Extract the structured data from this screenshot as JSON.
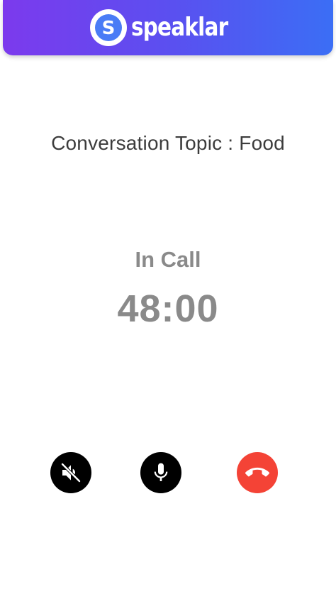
{
  "header": {
    "logo_text": "speaklar",
    "logo_letter": "S",
    "logo_icon": "speaklar-logo-icon",
    "gradient_start": "#7c3aed",
    "gradient_end": "#3b6ef5"
  },
  "call": {
    "topic": "Conversation Topic : Food",
    "status": "In Call",
    "timer": "48:00"
  },
  "controls": {
    "speaker": {
      "icon": "speaker-muted-icon",
      "color": "#000000"
    },
    "mic": {
      "icon": "mic-icon",
      "color": "#000000"
    },
    "end_call": {
      "icon": "phone-hangup-icon",
      "color": "#f44336"
    }
  }
}
